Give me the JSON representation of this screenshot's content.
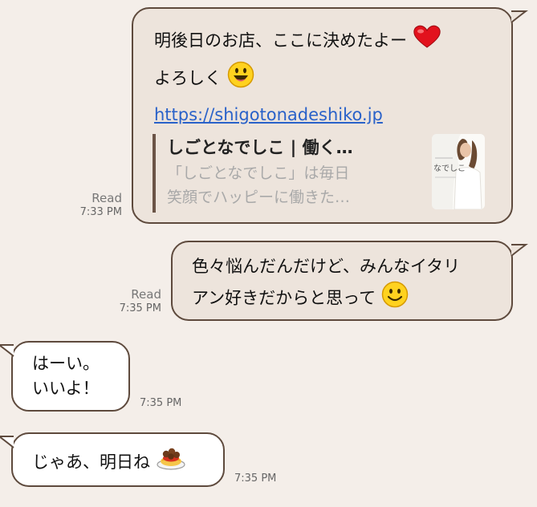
{
  "messages": [
    {
      "side": "sent",
      "lines": [
        "明後日のお店、ここに決めたよー",
        "よろしく"
      ],
      "icons": [
        "red-heart-icon",
        "grinning-face-icon"
      ],
      "link": "https://shigotonadeshiko.jp",
      "preview": {
        "title": "しごとなでしこ | 働く…",
        "desc_lines": [
          "「しごとなでしこ」は毎日",
          "笑顔でハッピーに働きた…"
        ],
        "thumb_text": "なでしこ"
      },
      "status": "Read",
      "time": "7:33 PM"
    },
    {
      "side": "sent",
      "lines": [
        "色々悩んだんだけど、みんなイタリ",
        "アン好きだからと思って"
      ],
      "icons": [
        "smiling-face-icon"
      ],
      "status": "Read",
      "time": "7:35 PM"
    },
    {
      "side": "received",
      "lines": [
        "はーい。",
        "いいよ！"
      ],
      "time": "7:35 PM"
    },
    {
      "side": "received",
      "lines": [
        "じゃあ、明日ね"
      ],
      "icons": [
        "spaghetti-icon"
      ],
      "time": "7:35 PM"
    }
  ]
}
